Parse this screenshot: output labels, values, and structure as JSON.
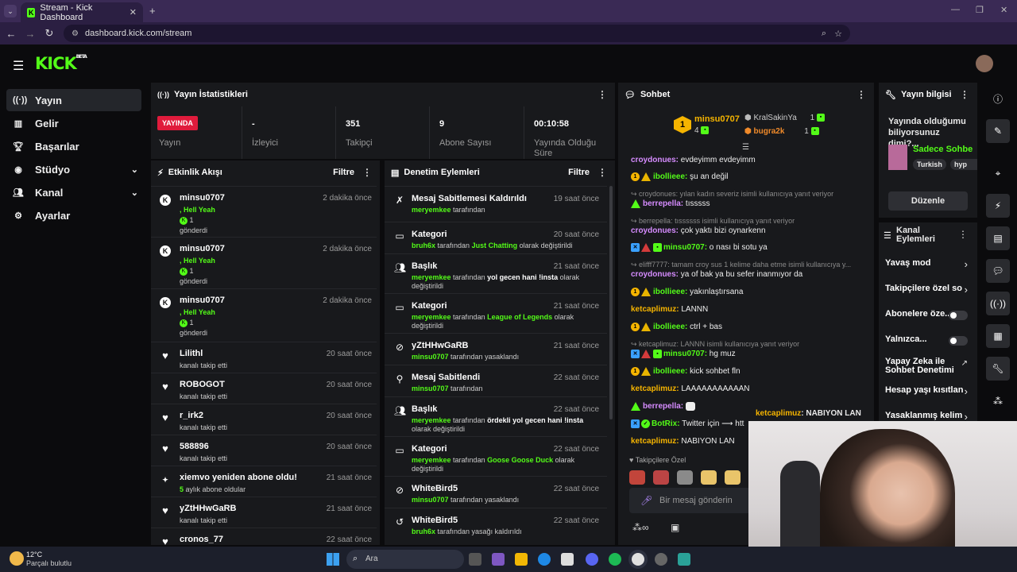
{
  "browser": {
    "tab_title": "Stream - Kick Dashboard",
    "url": "dashboard.kick.com/stream"
  },
  "app": {
    "logo": "KICK",
    "logo_tag": "BETA"
  },
  "sidebar": {
    "items": [
      {
        "label": "Yayın",
        "icon": "broadcast-icon",
        "active": true
      },
      {
        "label": "Gelir",
        "icon": "chart-icon"
      },
      {
        "label": "Başarılar",
        "icon": "trophy-icon"
      },
      {
        "label": "Stüdyo",
        "icon": "studio-icon",
        "expandable": true
      },
      {
        "label": "Kanal",
        "icon": "users-icon",
        "expandable": true
      },
      {
        "label": "Ayarlar",
        "icon": "gear-icon"
      }
    ]
  },
  "stats": {
    "title": "Yayın İstatistikleri",
    "live_badge": "YAYINDA",
    "items": [
      {
        "label": "Yayın",
        "value": ""
      },
      {
        "label": "İzleyici",
        "value": "-"
      },
      {
        "label": "Takipçi",
        "value": "351"
      },
      {
        "label": "Abone Sayısı",
        "value": "9"
      },
      {
        "label": "Yayında Olduğu Süre",
        "value": "00:10:58"
      }
    ]
  },
  "activity": {
    "title": "Etkinlik Akışı",
    "filter": "Filtre",
    "rows": [
      {
        "name": "minsu0707",
        "time": "2 dakika önce",
        "line1": ", Hell Yeah",
        "line2": "1",
        "line3": "gönderdi"
      },
      {
        "name": "minsu0707",
        "time": "2 dakika önce",
        "line1": ", Hell Yeah",
        "line2": "1",
        "line3": "gönderdi"
      },
      {
        "name": "minsu0707",
        "time": "2 dakika önce",
        "line1": ", Hell Yeah",
        "line2": "1",
        "line3": "gönderdi"
      },
      {
        "name": "Lilithl",
        "time": "20 saat önce",
        "line1": "kanalı takip etti"
      },
      {
        "name": "ROBOGOT",
        "time": "20 saat önce",
        "line1": "kanalı takip etti"
      },
      {
        "name": "r_irk2",
        "time": "20 saat önce",
        "line1": "kanalı takip etti"
      },
      {
        "name": "588896",
        "time": "20 saat önce",
        "line1": "kanalı takip etti"
      },
      {
        "name": "xiemvo yeniden abone oldu!",
        "time": "21 saat önce",
        "line1": "5 aylık abone oldular"
      },
      {
        "name": "yZtHHwGaRB",
        "time": "21 saat önce",
        "line1": "kanalı takip etti"
      },
      {
        "name": "cronos_77",
        "time": "22 saat önce",
        "line1": ""
      }
    ]
  },
  "modlog": {
    "title": "Denetim Eylemleri",
    "filter": "Filtre",
    "rows": [
      {
        "title": "Mesaj Sabitlemesi Kaldırıldı",
        "time": "19 saat önce",
        "user": "meryemkee",
        "rest": " tarafından"
      },
      {
        "title": "Kategori",
        "time": "20 saat önce",
        "user": "bruh6x",
        "rest": " tarafından ",
        "hl": "Just Chatting",
        "rest2": " olarak değiştirildi"
      },
      {
        "title": "Başlık",
        "time": "21 saat önce",
        "user": "meryemkee",
        "rest": " tarafından ",
        "bold": "yol gecen hani !insta",
        "rest2": " olarak değiştirildi"
      },
      {
        "title": "Kategori",
        "time": "21 saat önce",
        "user": "meryemkee",
        "rest": " tarafından ",
        "hl": "League of Legends",
        "rest2": "  olarak değiştirildi"
      },
      {
        "title": "yZtHHwGaRB",
        "time": "21 saat önce",
        "user": "minsu0707",
        "rest": " tarafından yasaklandı"
      },
      {
        "title": "Mesaj Sabitlendi",
        "time": "22 saat önce",
        "user": "minsu0707",
        "rest": " tarafından"
      },
      {
        "title": "Başlık",
        "time": "22 saat önce",
        "user": "meryemkee",
        "rest": " tarafından ",
        "bold": "ördekli yol gecen hani !insta",
        "rest2": " olarak değiştirildi"
      },
      {
        "title": "Kategori",
        "time": "22 saat önce",
        "user": "meryemkee",
        "rest": " tarafından ",
        "hl": "Goose Goose Duck",
        "rest2": " olarak değiştirildi"
      },
      {
        "title": "WhiteBird5",
        "time": "22 saat önce",
        "user": "minsu0707",
        "rest": " tarafından yasaklandı"
      },
      {
        "title": "WhiteBird5",
        "time": "22 saat önce",
        "user": "bruh6x",
        "rest": " tarafından yasağı kaldırıldı"
      }
    ]
  },
  "chat": {
    "title": "Sohbet",
    "leaderboard": {
      "top": {
        "rank": "1",
        "name": "minsu0707",
        "count": "4"
      },
      "second": {
        "name": "KralSakinYa",
        "count": "1"
      },
      "third": {
        "name": "bugra2k",
        "count": "1"
      }
    },
    "messages": [
      {
        "user": "croydonues",
        "text": "evdeyimm evdeyimm",
        "color": "#d68cff"
      },
      {
        "user": "ibollieee",
        "text": "şu an değil",
        "color": "#53fc18",
        "badges": "gold-warn"
      },
      {
        "reply": "croydonues: yılan kadın severiz isimli kullanıcıya yanıt veriyor"
      },
      {
        "user": "berrepella",
        "text": "tısssss",
        "color": "#d68cff",
        "badges": "green-tri"
      },
      {
        "reply": "berrepella: tıssssss isimli kullanıcıya yanıt veriyor"
      },
      {
        "user": "croydonues",
        "text": "çok yaktı bizi oynarkenn",
        "color": "#d68cff"
      },
      {
        "user": "minsu0707",
        "text": "o nası bi sotu ya",
        "color": "#53fc18",
        "badges": "mod-red-green"
      },
      {
        "reply": "elifff7777: tamam croy sus 1 kelime daha etme isimli kullanıcıya y..."
      },
      {
        "user": "croydonues",
        "text": "ya of bak ya bu sefer inanmıyor da",
        "color": "#d68cff"
      },
      {
        "user": "ibollieee",
        "text": "yakınlaştırsana",
        "color": "#53fc18",
        "badges": "gold-warn"
      },
      {
        "user": "ketcaplimuz",
        "text": "LANNN",
        "color": "#f5b400"
      },
      {
        "user": "ibollieee",
        "text": "ctrl + bas",
        "color": "#53fc18",
        "badges": "gold-warn"
      },
      {
        "reply": "ketcaplimuz: LANNN isimli kullanıcıya yanıt veriyor"
      },
      {
        "user": "minsu0707",
        "text": "hg muz",
        "color": "#53fc18",
        "badges": "mod-red-green"
      },
      {
        "user": "ibollieee",
        "text": "kick sohbet fln",
        "color": "#53fc18",
        "badges": "gold-warn"
      },
      {
        "user": "ketcaplimuz",
        "text": "LAAAAAAAAAAAN",
        "color": "#f5b400"
      },
      {
        "user": "berrepella",
        "text": "",
        "color": "#d68cff",
        "badges": "green-tri"
      },
      {
        "user": "BotRix",
        "text": "Twitter için ⟶ htt",
        "color": "#53fc18",
        "badges": "mod-check"
      },
      {
        "user": "ketcaplimuz",
        "text": "NABIYON LAN",
        "color": "#f5b400"
      }
    ],
    "overlay_user": "ketcaplimuz",
    "overlay_text": "NABIYON LAN",
    "followers_only": "Takipçilere Özel",
    "input_placeholder": "Bir mesaj gönderin"
  },
  "stream_info": {
    "title": "Yayın bilgisi",
    "question": "Yayında olduğumu biliyorsunuz dimi?...",
    "category": "Sadece Sohbe",
    "tags": [
      "Turkish",
      "hyp"
    ],
    "edit_button": "Düzenle"
  },
  "channel_actions": {
    "title": "Kanal Eylemleri",
    "items": [
      {
        "label": "Yavaş mod",
        "kind": "chevron"
      },
      {
        "label": "Takipçilere özel so",
        "kind": "chevron"
      },
      {
        "label": "Abonelere öze...",
        "kind": "toggle"
      },
      {
        "label": "Yalnızca...",
        "kind": "toggle"
      },
      {
        "label": "Yapay Zeka ile Sohbet Denetimi",
        "kind": "external"
      },
      {
        "label": "Hesap yaşı kısıtlan",
        "kind": "chevron"
      },
      {
        "label": "Yasaklanmış kelim",
        "kind": "chevron"
      }
    ]
  },
  "taskbar": {
    "weather_temp": "12°C",
    "weather_desc": "Parçalı bulutlu",
    "search": "Ara"
  }
}
